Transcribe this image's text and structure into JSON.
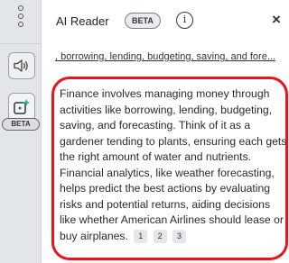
{
  "app": {
    "title": "AI Reader",
    "beta_label": "BETA",
    "close_glyph": "×",
    "info_glyph": "i"
  },
  "rail": {
    "items": [
      {
        "icon": "speaker-icon"
      },
      {
        "icon": "ai-sparkle-icon",
        "badge": "BETA"
      }
    ]
  },
  "topics_link": ", borrowing, lending, budgeting, saving, and fore...",
  "summary": {
    "text": "Finance involves managing money through activities like borrowing, lending, budgeting, saving, and forecasting. Think of it as a gardener tending to plants, ensuring each gets the right amount of water and nutrients. Financial analytics, like weather forecasting, helps predict the best actions by evaluating risks and potential returns, aiding decisions like whether American Airlines should lease or buy airplanes.",
    "citations": [
      "1",
      "2",
      "3"
    ],
    "highlight_color": "#e8141b"
  }
}
